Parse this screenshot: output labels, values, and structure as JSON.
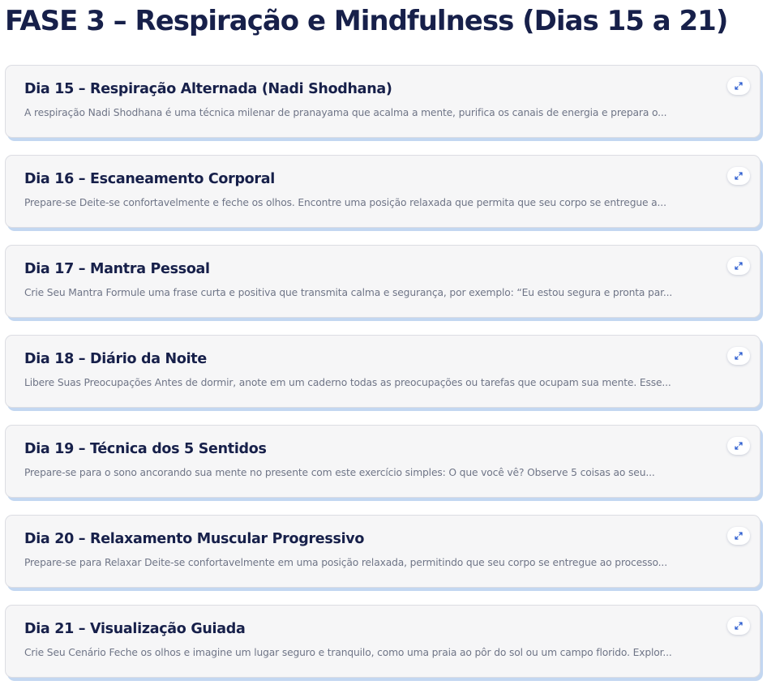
{
  "page_title": "FASE 3 – Respiração e Mindfulness (Dias 15 a 21)",
  "expand_icon": "expand-diagonal-arrows-icon",
  "accent_color": "#2f5fd0",
  "cards": [
    {
      "title": "Dia 15 – Respiração Alternada (Nadi Shodhana)",
      "excerpt": "A respiração Nadi Shodhana é uma técnica milenar de pranayama que acalma a mente, purifica os canais de energia e prepara o..."
    },
    {
      "title": "Dia 16 – Escaneamento Corporal",
      "excerpt": "Prepare-se Deite-se confortavelmente e feche os olhos. Encontre uma posição relaxada que permita que seu corpo se entregue a..."
    },
    {
      "title": "Dia 17 – Mantra Pessoal",
      "excerpt": "Crie Seu Mantra Formule uma frase curta e positiva que transmita calma e segurança, por exemplo: “Eu estou segura e pronta par..."
    },
    {
      "title": "Dia 18 – Diário da Noite",
      "excerpt": "Libere Suas Preocupações Antes de dormir, anote em um caderno todas as preocupações ou tarefas que ocupam sua mente. Esse..."
    },
    {
      "title": "Dia 19 – Técnica dos 5 Sentidos",
      "excerpt": "Prepare-se para o sono ancorando sua mente no presente com este exercício simples: O que você vê? Observe 5 coisas ao seu..."
    },
    {
      "title": "Dia 20 – Relaxamento Muscular Progressivo",
      "excerpt": "Prepare-se para Relaxar Deite-se confortavelmente em uma posição relaxada, permitindo que seu corpo se entregue ao processo..."
    },
    {
      "title": "Dia 21 – Visualização Guiada",
      "excerpt": "Crie Seu Cenário Feche os olhos e imagine um lugar seguro e tranquilo, como uma praia ao pôr do sol ou um campo florido. Explor..."
    }
  ]
}
